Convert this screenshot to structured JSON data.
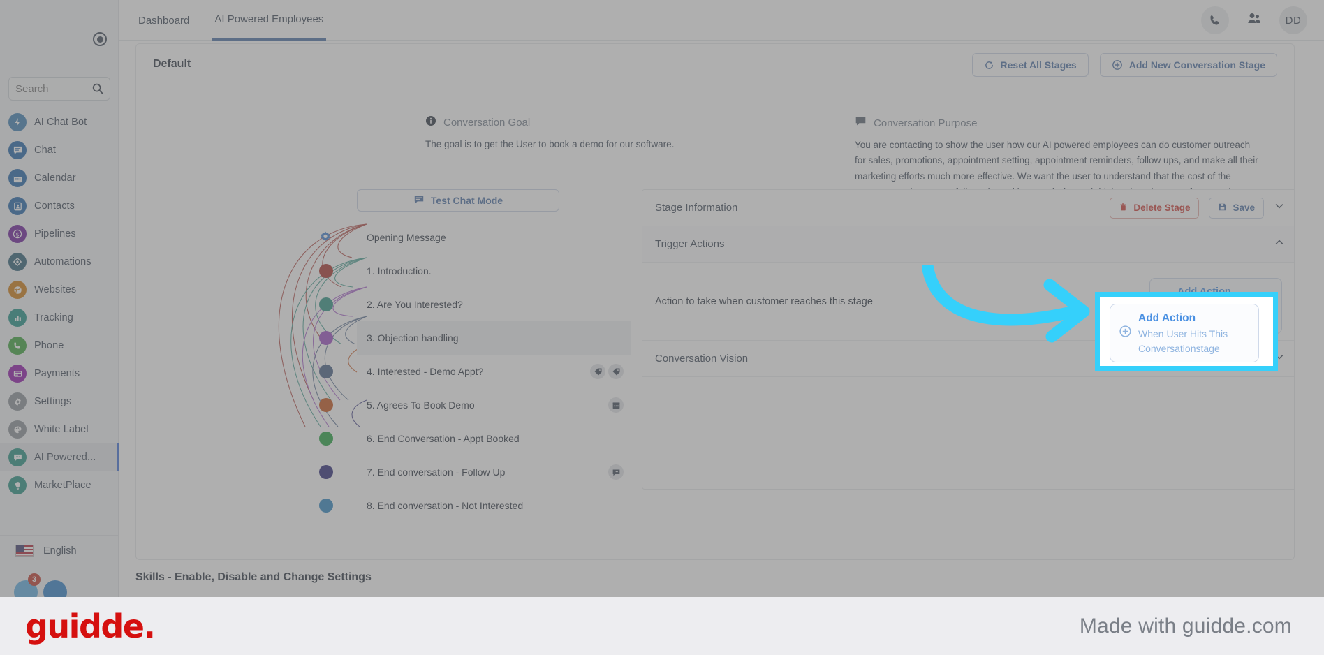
{
  "sidebar": {
    "search": {
      "value": "",
      "placeholder": "Search"
    },
    "collapse_icon": "collapse-circle-icon",
    "items": [
      {
        "label": "AI Chat Bot",
        "icon": "bolt-icon",
        "color": "#3d7fb3",
        "active": false
      },
      {
        "label": "Chat",
        "icon": "chat-icon",
        "color": "#1f64a8",
        "active": false
      },
      {
        "label": "Calendar",
        "icon": "calendar-icon",
        "color": "#1f64a8",
        "active": false
      },
      {
        "label": "Contacts",
        "icon": "contact-card-icon",
        "color": "#1f64a8",
        "active": false
      },
      {
        "label": "Pipelines",
        "icon": "dollar-icon",
        "color": "#6a1b9a",
        "active": false
      },
      {
        "label": "Automations",
        "icon": "workflow-icon",
        "color": "#2d5f77",
        "active": false
      },
      {
        "label": "Websites",
        "icon": "globe-icon",
        "color": "#cf7a10",
        "active": false
      },
      {
        "label": "Tracking",
        "icon": "bar-chart-icon",
        "color": "#1d9186",
        "active": false
      },
      {
        "label": "Phone",
        "icon": "phone-icon",
        "color": "#3aa23a",
        "active": false
      },
      {
        "label": "Payments",
        "icon": "credit-card-icon",
        "color": "#8e12a8",
        "active": false
      },
      {
        "label": "Settings",
        "icon": "gear-icon",
        "color": "#8b9098",
        "active": false
      },
      {
        "label": "White Label",
        "icon": "palette-icon",
        "color": "#8b9098",
        "active": false
      },
      {
        "label": "AI Powered...",
        "icon": "ai-chat-icon",
        "color": "#249182",
        "active": true
      },
      {
        "label": "MarketPlace",
        "icon": "bulb-icon",
        "color": "#249182",
        "active": false
      }
    ],
    "language": {
      "label": "English",
      "flag": "us-flag-icon"
    },
    "chat_badge_count": "3"
  },
  "topbar": {
    "tabs": [
      {
        "label": "Dashboard",
        "active": false
      },
      {
        "label": "AI Powered Employees",
        "active": true
      }
    ],
    "phone_icon": "phone-icon",
    "people_icon": "people-icon",
    "avatar_initials": "DD"
  },
  "card": {
    "title": "Default",
    "reset_button": "Reset All Stages",
    "add_stage_button": "Add New Conversation Stage",
    "goal": {
      "heading": "Conversation Goal",
      "icon": "info-icon",
      "text": "The goal is to get the User to book a demo for our software."
    },
    "purpose": {
      "heading": "Conversation Purpose",
      "icon": "message-icon",
      "text": "You are contacting to show the user how our AI powered employees can do customer outreach for sales, promotions, appointment setting, appointment reminders, follow ups, and make all their marketing efforts much more effective. We want the user to understand that the cost of the customers, who are not followed up with properly, is much higher than the cost of our service."
    },
    "test_chat_button": "Test Chat Mode",
    "stages": [
      {
        "label": "Opening Message",
        "icon": "gear-icon",
        "dot": null,
        "selected": false,
        "row_icons": []
      },
      {
        "label": "1. Introduction.",
        "icon": null,
        "dot": "#a8312a",
        "selected": false,
        "row_icons": []
      },
      {
        "label": "2. Are You Interested?",
        "icon": null,
        "dot": "#2e9384",
        "selected": false,
        "row_icons": []
      },
      {
        "label": "3. Objection handling",
        "icon": null,
        "dot": "#9b4cc4",
        "selected": true,
        "row_icons": []
      },
      {
        "label": "4. Interested - Demo Appt?",
        "icon": null,
        "dot": "#465f85",
        "selected": false,
        "row_icons": [
          "tag-icon",
          "tag-icon"
        ]
      },
      {
        "label": "5. Agrees To Book Demo",
        "icon": null,
        "dot": "#c6531a",
        "selected": false,
        "row_icons": [
          "calendar-icon"
        ]
      },
      {
        "label": "6. End Conversation - Appt Booked",
        "icon": null,
        "dot": "#23a33f",
        "selected": false,
        "row_icons": []
      },
      {
        "label": "7. End conversation - Follow Up",
        "icon": null,
        "dot": "#2b2878",
        "selected": false,
        "row_icons": [
          "message-icon"
        ]
      },
      {
        "label": "8. End conversation - Not Interested",
        "icon": null,
        "dot": "#2e86c1",
        "selected": false,
        "row_icons": []
      }
    ],
    "panel": {
      "stage_information": {
        "title": "Stage Information",
        "delete_button": "Delete Stage",
        "save_button": "Save",
        "chevron": "chevron-down-icon"
      },
      "trigger_actions": {
        "title": "Trigger Actions",
        "chevron": "chevron-up-icon",
        "body_text": "Action to take when customer reaches this stage",
        "add_action": {
          "title": "Add Action",
          "subtitle": "When User Hits This Conversationstage",
          "icon": "plus-circle-icon"
        }
      },
      "conversation_vision": {
        "title": "Conversation Vision",
        "chevron": "chevron-down-icon"
      }
    },
    "skills_heading": "Skills - Enable, Disable and Change Settings"
  },
  "highlight": {
    "color": "#35d0fb",
    "arrow_icon": "curved-arrow-icon",
    "add_action_title": "Add Action",
    "add_action_subtitle": "When User Hits This Conversationstage",
    "plus_icon": "plus-circle-icon"
  },
  "footer": {
    "logo_text": "guidde.",
    "tagline": "Made with guidde.com"
  }
}
